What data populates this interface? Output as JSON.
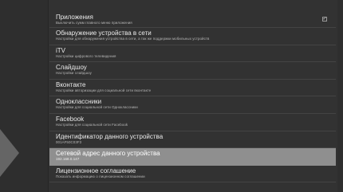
{
  "menu": {
    "items": [
      {
        "title": "Приложения",
        "subtitle": "Выключить сумм главного меню приложения",
        "checkbox": "✓"
      },
      {
        "title": "Обнаружение устройства в сети",
        "subtitle": "Настройки для обнаружения устройства в сети, а так же поддержки мобильных устройств"
      },
      {
        "title": "iTV",
        "subtitle": "Настройки цифрового телевидения"
      },
      {
        "title": "Слайдшоу",
        "subtitle": "Настройки слайдшоу"
      },
      {
        "title": "Вконтакте",
        "subtitle": "Настройки авторизации для социальной сети вконтакте"
      },
      {
        "title": "Одноклассники",
        "subtitle": "Настройки для социальной сети Одноклассники"
      },
      {
        "title": "Facebook",
        "subtitle": "Настройки для социальной сети Facebook"
      },
      {
        "title": "Идентификатор данного устройства",
        "subtitle": "001AF50C03F3"
      },
      {
        "title": "Сетевой адрес данного устройства",
        "subtitle": "192.168.0.147"
      },
      {
        "title": "Лицензионное соглашение",
        "subtitle": "Показать информацию о лицензионном соглашении"
      }
    ]
  },
  "colors": {
    "background": "#2e2e2e",
    "panel": "#323232",
    "selected_row": "#8f8f8f",
    "text": "#eaeaea"
  }
}
